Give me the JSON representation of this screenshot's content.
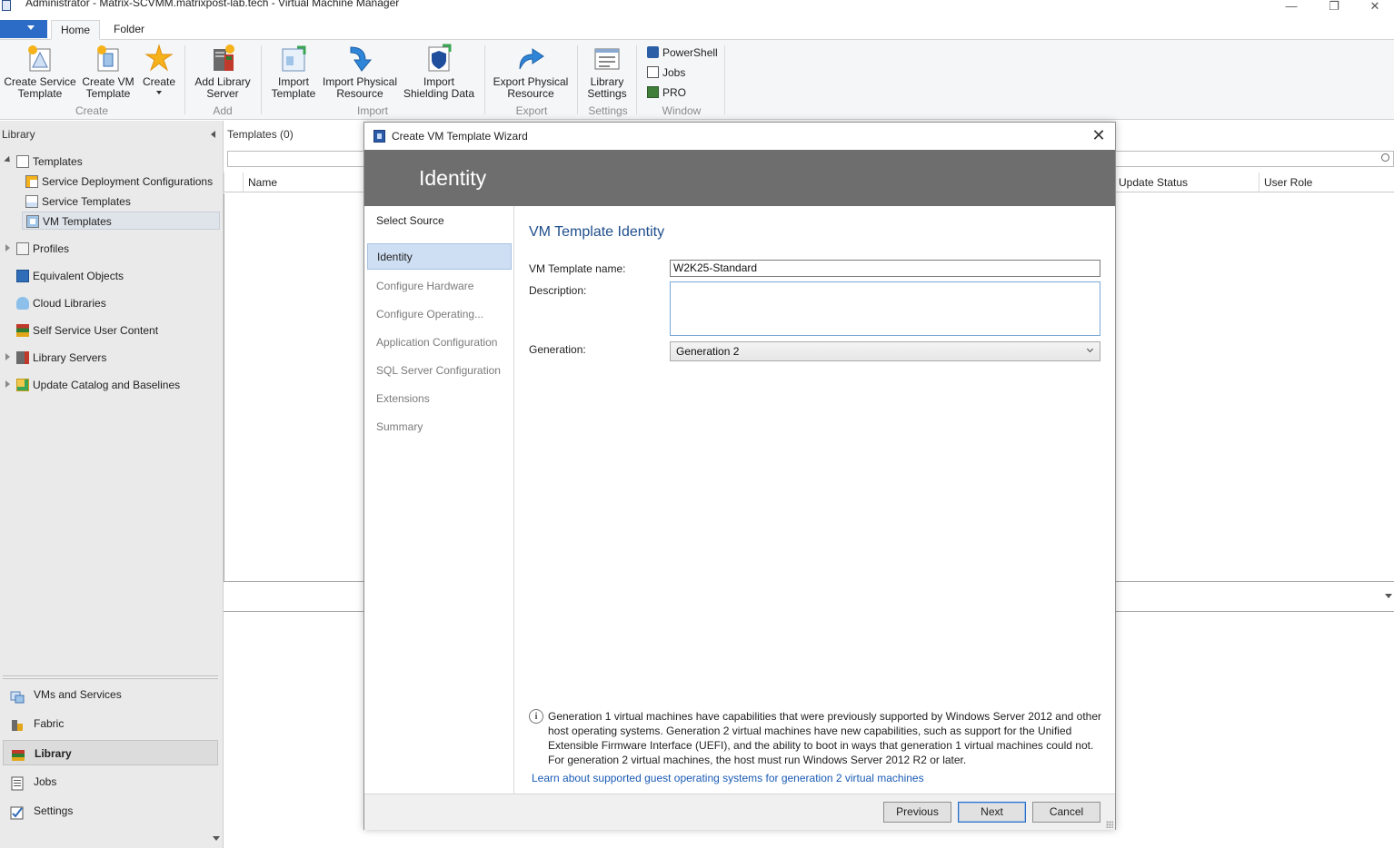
{
  "window": {
    "title": "Administrator - Matrix-SCVMM.matrixpost-lab.tech - Virtual Machine Manager",
    "minimize": "—",
    "restore": "❐",
    "close": "✕"
  },
  "ribbon": {
    "tabs": [
      "Home",
      "Folder"
    ],
    "buttons": {
      "create_service_template": "Create Service Template",
      "create_vm_template": "Create VM Template",
      "create": "Create",
      "add_library_server": "Add Library Server",
      "import_template": "Import Template",
      "import_physical_resource": "Import Physical Resource",
      "import_shielding_data": "Import Shielding Data",
      "export_physical_resource": "Export Physical Resource",
      "library_settings": "Library Settings",
      "powershell": "PowerShell",
      "jobs": "Jobs",
      "pro": "PRO"
    },
    "groups": {
      "create": "Create",
      "add": "Add",
      "import": "Import",
      "export": "Export",
      "settings": "Settings",
      "window": "Window"
    }
  },
  "library_pane": {
    "title": "Library",
    "tree": {
      "templates": "Templates",
      "service_deployment_configurations": "Service Deployment Configurations",
      "service_templates": "Service Templates",
      "vm_templates": "VM Templates",
      "profiles": "Profiles",
      "equivalent_objects": "Equivalent Objects",
      "cloud_libraries": "Cloud Libraries",
      "self_service_user_content": "Self Service User Content",
      "library_servers": "Library Servers",
      "update_catalog": "Update Catalog and Baselines"
    },
    "workspaces": {
      "vms_and_services": "VMs and Services",
      "fabric": "Fabric",
      "library": "Library",
      "jobs": "Jobs",
      "settings": "Settings"
    }
  },
  "main": {
    "title": "Templates (0)",
    "columns": {
      "name": "Name",
      "update_status": "Update Status",
      "user_role": "User Role"
    }
  },
  "wizard": {
    "title": "Create VM Template Wizard",
    "header": "Identity",
    "steps": {
      "select_source": "Select Source",
      "identity": "Identity",
      "configure_hardware": "Configure Hardware",
      "configure_operating": "Configure Operating...",
      "application_configuration": "Application Configuration",
      "sql_server_configuration": "SQL Server Configuration",
      "extensions": "Extensions",
      "summary": "Summary"
    },
    "content_title": "VM Template Identity",
    "fields": {
      "name_label": "VM Template name:",
      "name_value": "W2K25-Standard",
      "description_label": "Description:",
      "description_value": "",
      "generation_label": "Generation:",
      "generation_value": "Generation 2"
    },
    "info_text": "Generation 1 virtual machines have capabilities that were previously supported by Windows Server 2012 and other host operating systems. Generation 2 virtual machines have new capabilities, such as support for the Unified Extensible Firmware Interface (UEFI), and the ability to boot in ways that generation 1 virtual machines could not. For generation 2 virtual machines, the host must run Windows Server 2012 R2 or later.",
    "info_link": "Learn about supported guest operating systems for generation 2 virtual machines",
    "buttons": {
      "previous": "Previous",
      "next": "Next",
      "cancel": "Cancel"
    }
  },
  "colors": {
    "accent": "#2c6cc6",
    "wizard_header": "#6e6e6e",
    "selected_step": "#cfdff3",
    "link": "#1a5bb4",
    "content_title": "#1f4e8c"
  }
}
